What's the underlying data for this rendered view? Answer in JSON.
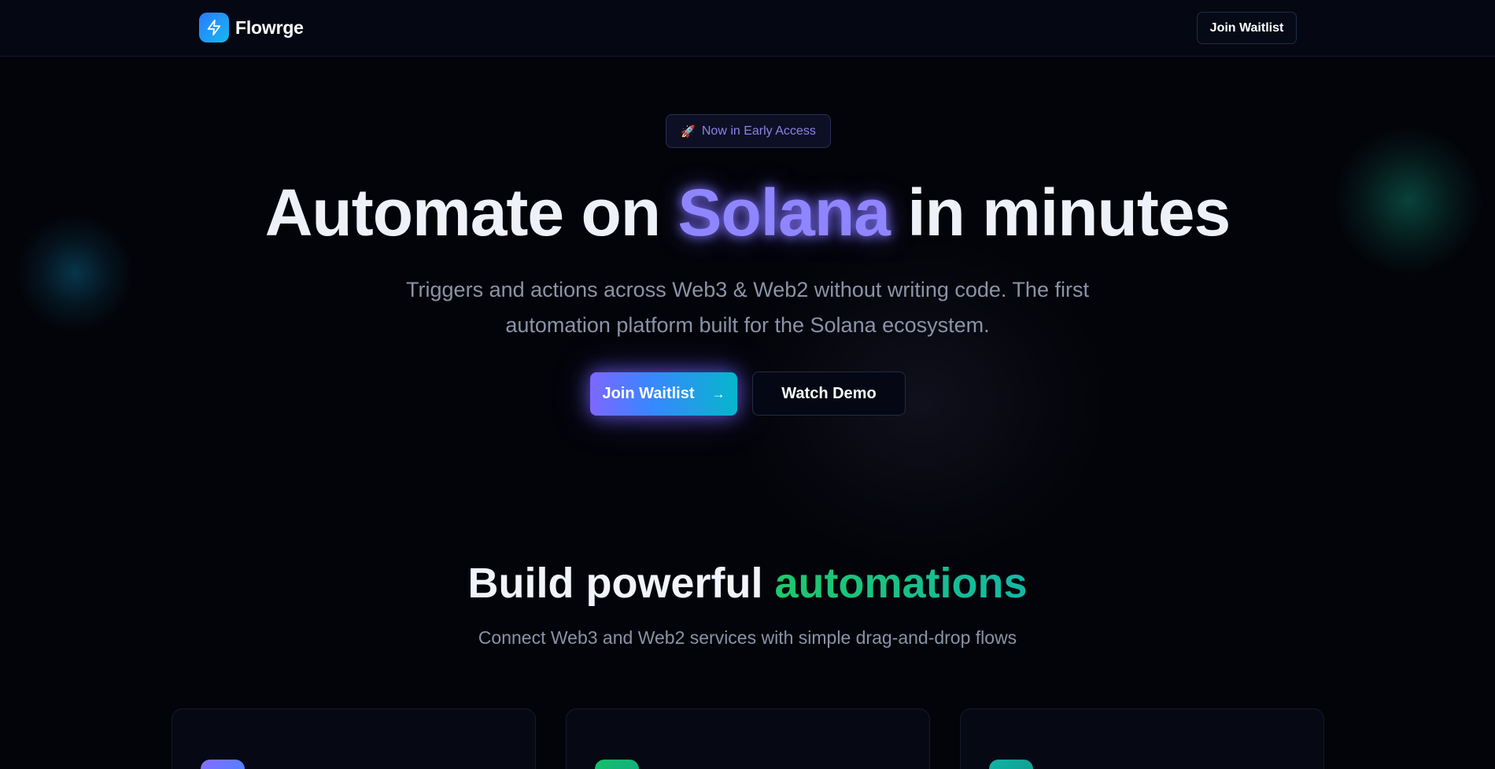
{
  "header": {
    "brand_name": "Flowrge",
    "logo_icon": "lightning-bolt-icon",
    "cta_label": "Join Waitlist"
  },
  "hero": {
    "badge_icon": "rocket-icon",
    "badge_text": "Now in Early Access",
    "title_before": "Automate on",
    "title_accent": "Solana",
    "title_after": "in minutes",
    "subtitle": "Triggers and actions across Web3 & Web2 without writing code. The first automation platform built for the Solana ecosystem.",
    "primary_cta": "Join Waitlist",
    "primary_cta_icon": "arrow-right-icon",
    "secondary_cta": "Watch Demo"
  },
  "features": {
    "title_before": "Build powerful",
    "title_accent": "automations",
    "subtitle": "Connect Web3 and Web2 services with simple drag-and-drop flows"
  },
  "colors": {
    "background": "#030409",
    "accent_purple": "#8f86ff",
    "accent_green": "#1ec86a",
    "accent_teal": "#14b8a6",
    "brand_blue": "#2a7bff"
  }
}
